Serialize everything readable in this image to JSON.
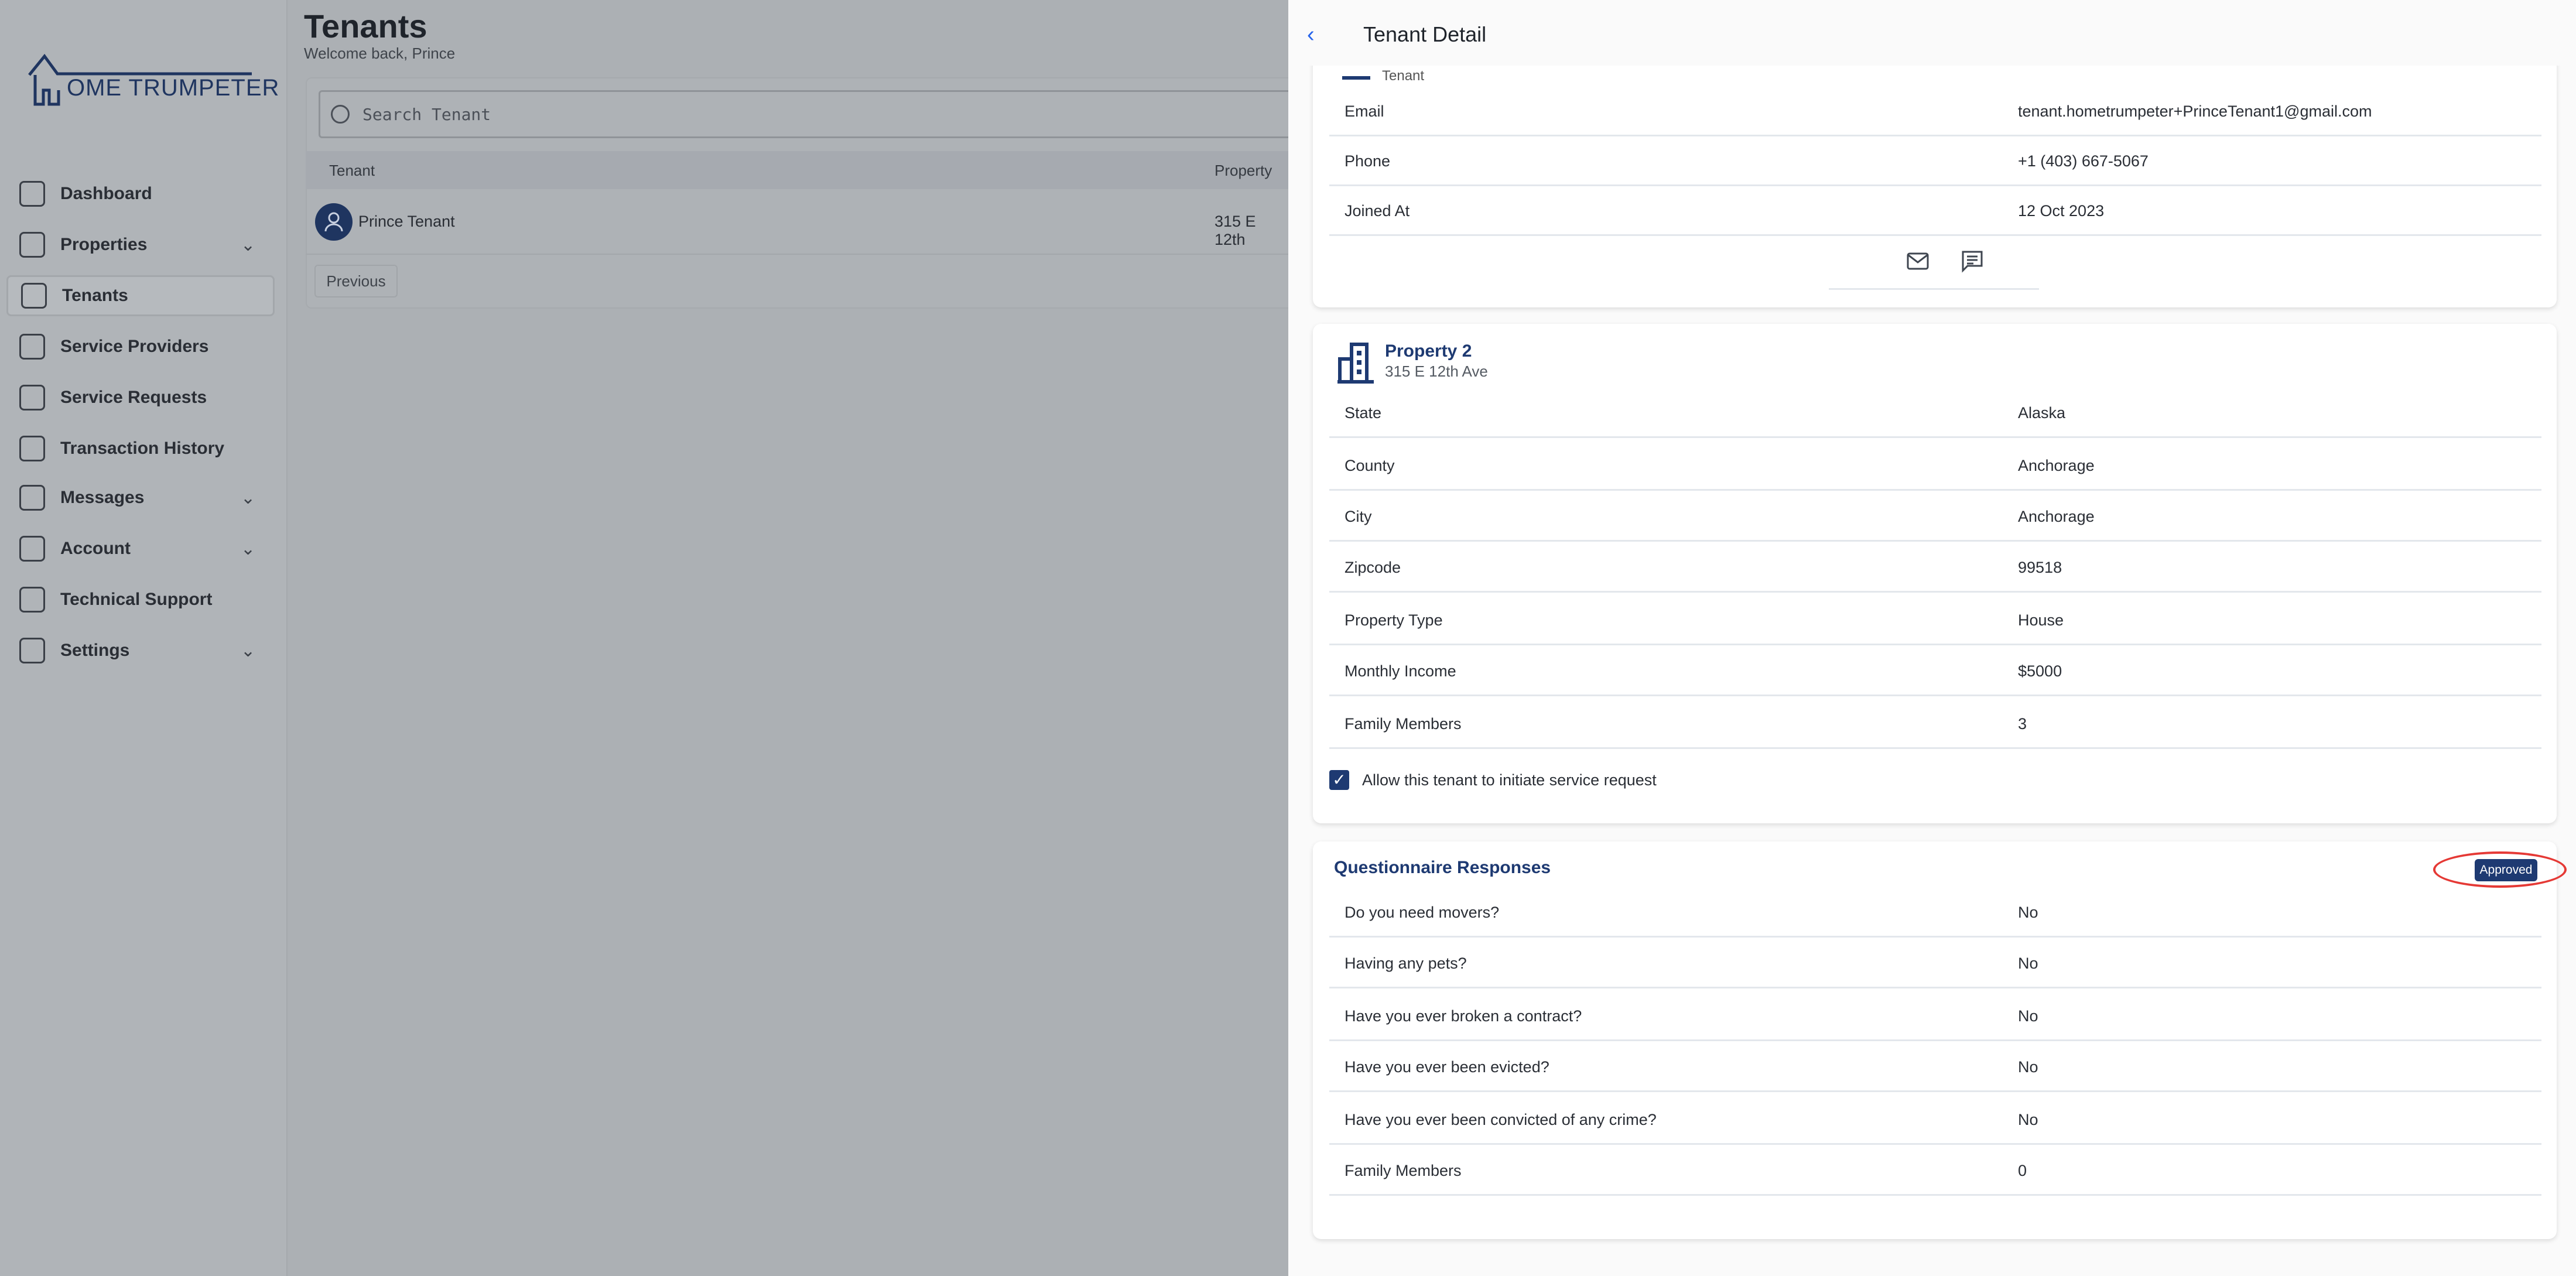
{
  "logo": {
    "text": "OME TRUMPETER",
    "full": "HOME TRUMPETER"
  },
  "sidebar": {
    "items": [
      {
        "label": "Dashboard",
        "icon": "chart-icon",
        "chevron": false
      },
      {
        "label": "Properties",
        "icon": "home-icon",
        "chevron": true
      },
      {
        "label": "Tenants",
        "icon": "users-icon",
        "chevron": false,
        "selected": true
      },
      {
        "label": "Service Providers",
        "icon": "tools-icon",
        "chevron": false
      },
      {
        "label": "Service Requests",
        "icon": "layers-icon",
        "chevron": false
      },
      {
        "label": "Transaction History",
        "icon": "bank-icon",
        "chevron": false
      },
      {
        "label": "Messages",
        "icon": "chat-icon",
        "chevron": true
      },
      {
        "label": "Account",
        "icon": "document-icon",
        "chevron": true
      },
      {
        "label": "Technical Support",
        "icon": "lifebuoy-icon",
        "chevron": false
      },
      {
        "label": "Settings",
        "icon": "gear-icon",
        "chevron": true
      }
    ]
  },
  "main": {
    "title": "Tenants",
    "welcome": "Welcome back, Prince",
    "search_placeholder": "Search Tenant",
    "columns": [
      "Tenant",
      "Property"
    ],
    "row": {
      "tenant": "Prince Tenant",
      "property": "315 E 12th"
    },
    "previous": "Previous"
  },
  "panel": {
    "title": "Tenant Detail",
    "partial_label": "Tenant",
    "contact": [
      {
        "k": "Email",
        "v": "tenant.hometrumpeter+PrinceTenant1@gmail.com"
      },
      {
        "k": "Phone",
        "v": "+1 (403) 667-5067"
      },
      {
        "k": "Joined At",
        "v": "12 Oct 2023"
      }
    ],
    "property": {
      "name": "Property 2",
      "address": "315 E 12th Ave",
      "rows": [
        {
          "k": "State",
          "v": "Alaska"
        },
        {
          "k": "County",
          "v": "Anchorage"
        },
        {
          "k": "City",
          "v": "Anchorage"
        },
        {
          "k": "Zipcode",
          "v": "99518"
        },
        {
          "k": "Property Type",
          "v": "House"
        },
        {
          "k": "Monthly Income",
          "v": "$5000"
        },
        {
          "k": "Family Members",
          "v": "3"
        }
      ],
      "checkbox_label": "Allow this tenant to initiate service request",
      "checkbox_checked": true
    },
    "questionnaire": {
      "title": "Questionnaire Responses",
      "status": "Approved",
      "rows": [
        {
          "k": "Do you need movers?",
          "v": "No"
        },
        {
          "k": "Having any pets?",
          "v": "No"
        },
        {
          "k": "Have you ever broken a contract?",
          "v": "No"
        },
        {
          "k": "Have you ever been evicted?",
          "v": "No"
        },
        {
          "k": "Have you ever been convicted of any crime?",
          "v": "No"
        },
        {
          "k": "Family Members",
          "v": "0"
        }
      ]
    }
  },
  "colors": {
    "brand": "#1e3a72",
    "accent": "#2563eb",
    "highlight": "#e53935"
  }
}
